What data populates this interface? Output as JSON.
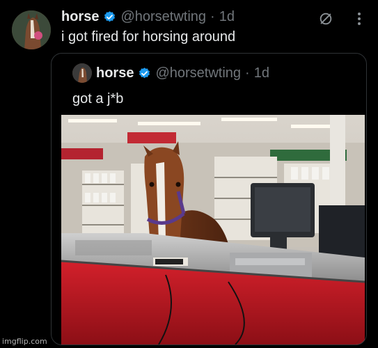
{
  "post": {
    "author_name": "horse",
    "handle": "@horsetwting",
    "separator": "·",
    "time": "1d",
    "text": "i got fired for horsing around",
    "icons": [
      "verified-badge-icon",
      "grok-slash-icon",
      "more-options-icon"
    ]
  },
  "quoted_post": {
    "author_name": "horse",
    "handle": "@horsetwting",
    "separator": "·",
    "time": "1d",
    "text": "got a j*b",
    "photo_desc": "horse-at-checkout-counter"
  },
  "watermark": "imgflip.com",
  "colors": {
    "background": "#000000",
    "text": "#e7e9ea",
    "muted": "#71767b",
    "verified": "#1d9bf0",
    "border": "#2f3336"
  }
}
